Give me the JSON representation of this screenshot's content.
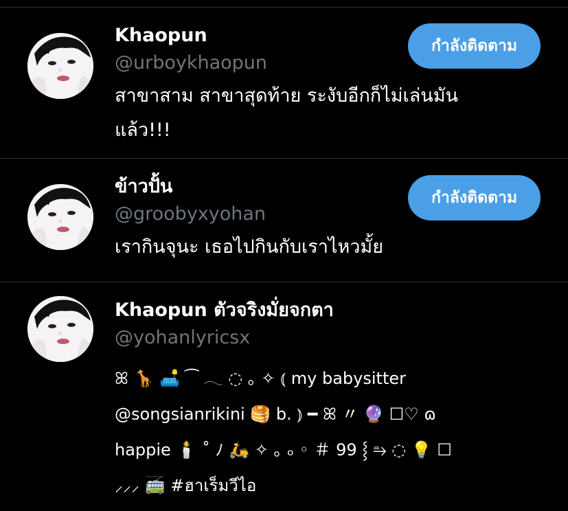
{
  "accounts": [
    {
      "name": "Khaopun",
      "handle": "@urboykhaopun",
      "bio_lines": [
        "สาขาสาม สาขาสุดท้าย ระงับอีกก็ไม่เล่นมัน",
        "แล้ว!!!"
      ],
      "follow_label": "กำลังติดตาม"
    },
    {
      "name": "ข้าวปั้น",
      "handle": "@groobyxyohan",
      "bio_lines": [
        "เรากินจุนะ เธอไปกินกับเราไหวมั้ย"
      ],
      "follow_label": "กำลังติดตาม"
    },
    {
      "name": "Khaopun ตัวจริงมั่ยจกตา",
      "handle": "@yohanlyricsx",
      "bio_lines": [
        "ꕤ 🦒 🛋️ ⁀ 𓂃 ◌ ｡ ✧ ⦅ my babysitter",
        "@songsianrikini 🥞 b. ⦆ ━ ꕤ 〃 🔮 ☐♡ ɷ",
        "happie 🕯️ ˚ ﾉ 🛵 ✧ ｡ ₒ ◦ ＃ 99 ⸾ ⥱ ◌ 💡 ☐",
        "⸝⸝⸝ 🚎 #ฮาเร็มวีไอ"
      ]
    }
  ],
  "colors": {
    "background": "#000000",
    "divider": "#2f3336",
    "name": "#ffffff",
    "handle": "#6e767d",
    "follow_button": "#4a9fe6"
  },
  "icons": {
    "avatar": "avatar-illustration"
  }
}
